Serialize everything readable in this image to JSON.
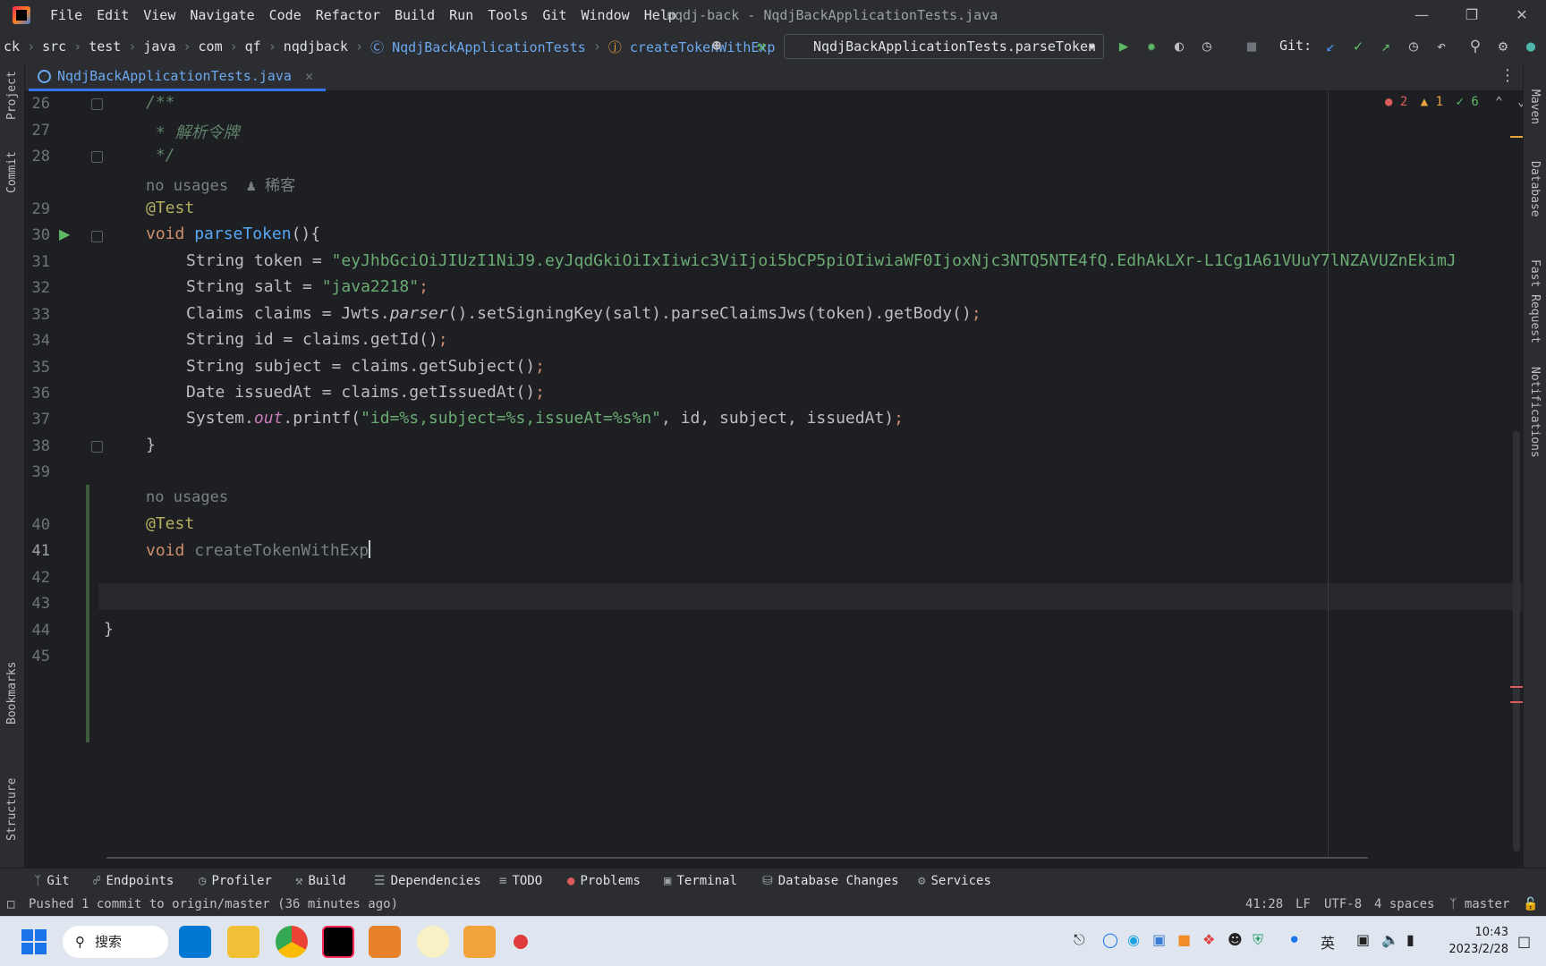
{
  "window": {
    "title": "nqdj-back - NqdjBackApplicationTests.java",
    "menu": [
      "File",
      "Edit",
      "View",
      "Navigate",
      "Code",
      "Refactor",
      "Build",
      "Run",
      "Tools",
      "Git",
      "Window",
      "Help"
    ]
  },
  "breadcrumbs": [
    "ck",
    "src",
    "test",
    "java",
    "com",
    "qf",
    "nqdjback",
    "NqdjBackApplicationTests",
    "createTokenWithExp"
  ],
  "run_config": "NqdjBackApplicationTests.parseToken",
  "git_label": "Git:",
  "tab": {
    "label": "NqdjBackApplicationTests.java"
  },
  "inspection": {
    "errors": "2",
    "warnings": "1",
    "ok": "6"
  },
  "left_tools": [
    "Project",
    "Commit",
    "Bookmarks",
    "Structure"
  ],
  "right_tools": [
    "Maven",
    "Database",
    "Fast Request",
    "Notifications"
  ],
  "editor": {
    "line_numbers": [
      "26",
      "27",
      "28",
      "29",
      "30",
      "31",
      "32",
      "33",
      "34",
      "35",
      "36",
      "37",
      "38",
      "39",
      "40",
      "41",
      "42",
      "43",
      "44",
      "45"
    ],
    "current_line": "41",
    "inlays": {
      "no_usages": "no usages",
      "author": "稀客"
    },
    "code": {
      "l26": "/**",
      "l27": " * 解析令牌",
      "l28": " */",
      "l29": "@Test",
      "l30_kw": "void ",
      "l30_fn": "parseToken",
      "l30_rest": "(){",
      "l31_a": "String token = ",
      "l31_s": "\"eyJhbGciOiJIUzI1NiJ9.eyJqdGkiOiIxIiwic3ViIjoi5bCP5piOIiwiaWF0IjoxNjc3NTQ5NTE4fQ.EdhAkLXr-L1Cg1A61VUuY7lNZAVUZnEkimJ",
      "l32_a": "String salt = ",
      "l32_s": "\"java2218\"",
      "l33_a": "Claims claims = Jwts.",
      "l33_i": "parser",
      "l33_b": "().setSigningKey(salt).parseClaimsJws(token).getBody()",
      "l34": "String id = claims.getId()",
      "l35": "String subject = claims.getSubject()",
      "l36": "Date issuedAt = claims.getIssuedAt()",
      "l37_a": "System.",
      "l37_f": "out",
      "l37_b": ".printf(",
      "l37_s": "\"id=%s,subject=%s,issueAt=%s%n\"",
      "l37_c": ", id, subject, issuedAt)",
      "l38": "}",
      "l40": "@Test",
      "l41_kw": "void ",
      "l41_fn": "createTokenWithExp",
      "l44": "}",
      "semi": ";"
    }
  },
  "bottom_tools": [
    "Git",
    "Endpoints",
    "Profiler",
    "Build",
    "Dependencies",
    "TODO",
    "Problems",
    "Terminal",
    "Database Changes",
    "Services"
  ],
  "status": {
    "message": "Pushed 1 commit to origin/master (36 minutes ago)",
    "position": "41:28",
    "line_sep": "LF",
    "encoding": "UTF-8",
    "indent": "4 spaces",
    "branch": "master"
  },
  "taskbar": {
    "search": "搜索",
    "ime": "英",
    "time": "10:43",
    "date": "2023/2/28"
  }
}
